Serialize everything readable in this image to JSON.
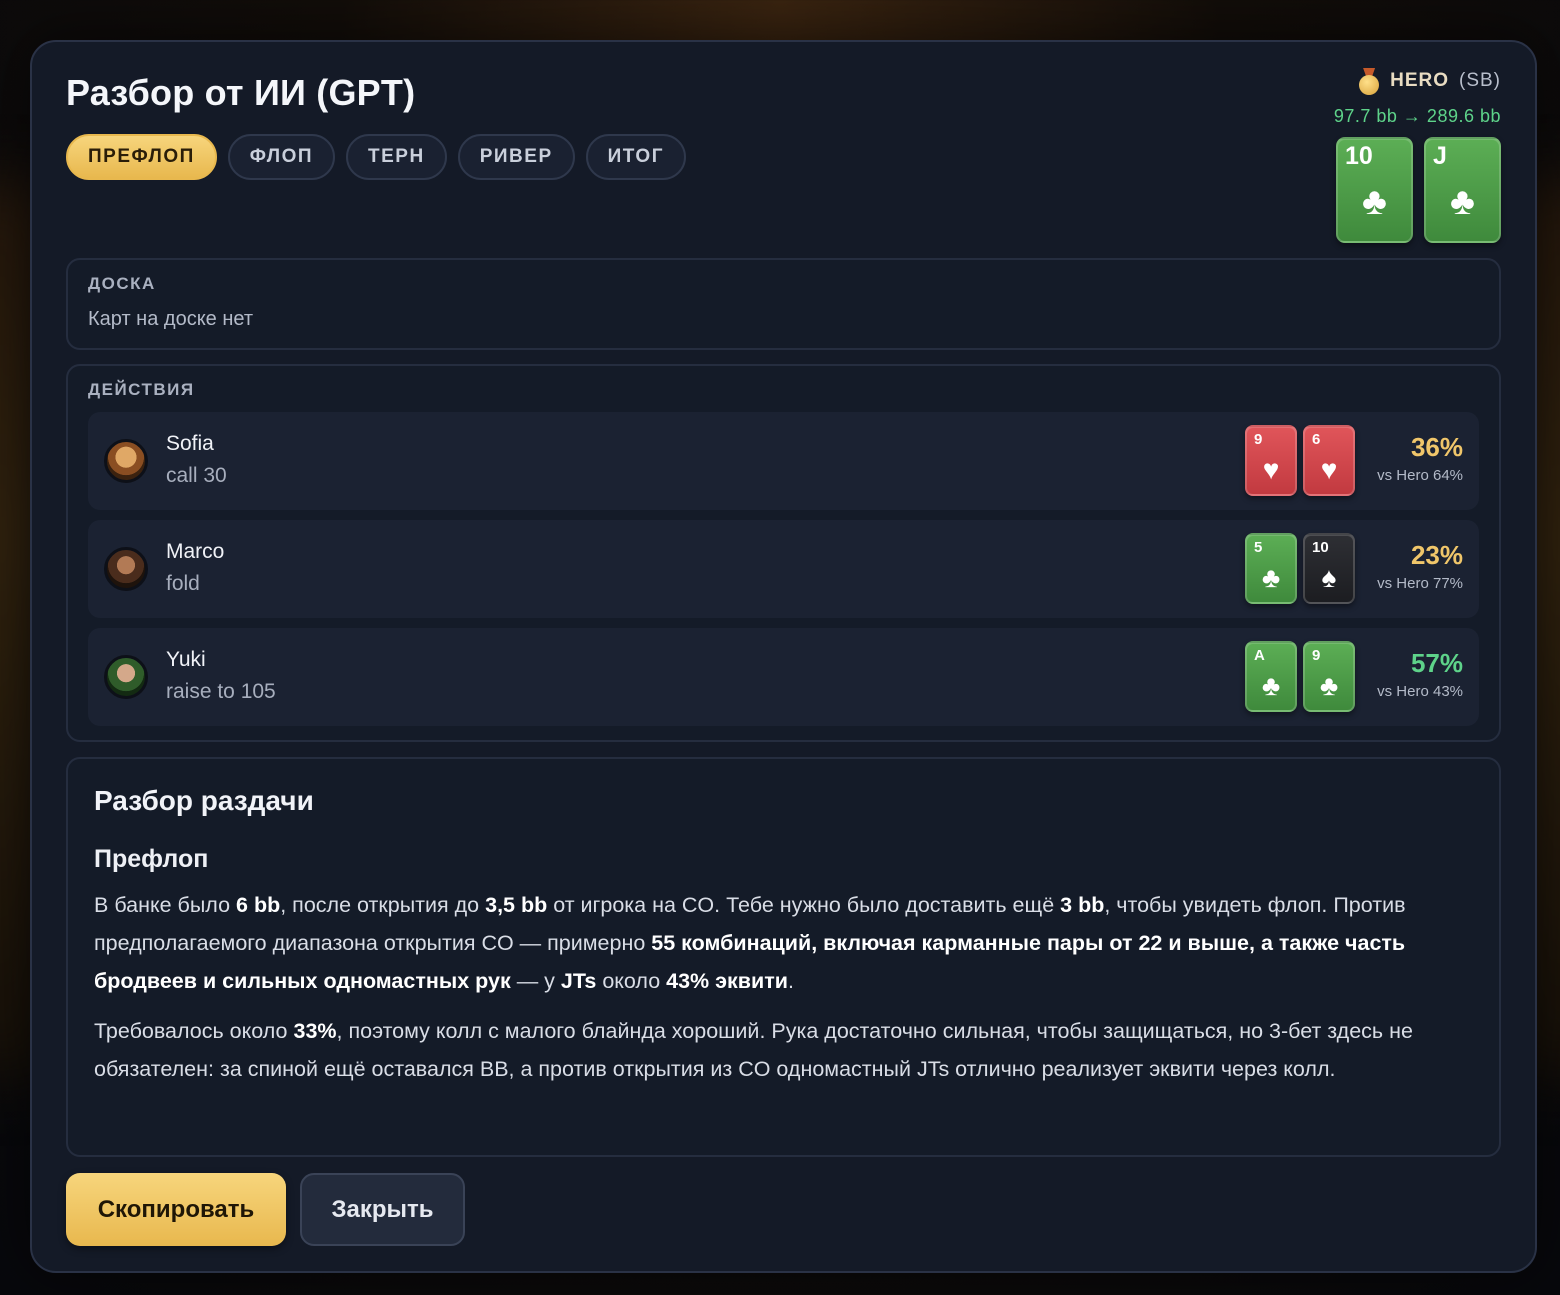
{
  "modal": {
    "title": "Разбор от ИИ (GPT)"
  },
  "tabs": [
    {
      "label": "ПРЕФЛОП",
      "active": true
    },
    {
      "label": "ФЛОП"
    },
    {
      "label": "ТЕРН"
    },
    {
      "label": "РИВЕР"
    },
    {
      "label": "ИТОГ"
    }
  ],
  "hero": {
    "name": "HERO",
    "position": "(SB)",
    "stack": "97.7 bb → 289.6 bb",
    "cards": [
      {
        "rank": "10",
        "suit": "♣",
        "color": "green"
      },
      {
        "rank": "J",
        "suit": "♣",
        "color": "green"
      }
    ]
  },
  "board": {
    "label": "ДОСКА",
    "empty_text": "Карт на доске нет"
  },
  "actions": {
    "label": "ДЕЙСТВИЯ",
    "rows": [
      {
        "player": "Sofia",
        "action": "call 30",
        "cards": [
          {
            "rank": "9",
            "suit": "♥",
            "color": "red"
          },
          {
            "rank": "6",
            "suit": "♥",
            "color": "red"
          }
        ],
        "equity": "36%",
        "vs": "vs Hero 64%",
        "equity_color": "#f0c66a"
      },
      {
        "player": "Marco",
        "action": "fold",
        "cards": [
          {
            "rank": "5",
            "suit": "♣",
            "color": "green"
          },
          {
            "rank": "10",
            "suit": "♠",
            "color": "black"
          }
        ],
        "equity": "23%",
        "vs": "vs Hero 77%",
        "equity_color": "#f0c66a"
      },
      {
        "player": "Yuki",
        "action": "raise to 105",
        "cards": [
          {
            "rank": "A",
            "suit": "♣",
            "color": "green"
          },
          {
            "rank": "9",
            "suit": "♣",
            "color": "green"
          }
        ],
        "equity": "57%",
        "vs": "vs Hero 43%",
        "equity_color": "#5ed38a"
      }
    ]
  },
  "analysis": {
    "title": "Разбор раздачи",
    "section": "Префлоп",
    "p1": [
      {
        "t": "В банке было "
      },
      {
        "t": "6 bb",
        "b": true
      },
      {
        "t": ", после открытия до "
      },
      {
        "t": "3,5 bb",
        "b": true
      },
      {
        "t": " от игрока на CO. Тебе нужно было доставить ещё "
      },
      {
        "t": "3 bb",
        "b": true
      },
      {
        "t": ", чтобы увидеть флоп. Против предполагаемого диапазона открытия CO — примерно "
      },
      {
        "t": "55 комбинаций, включая карманные пары от 22 и выше, а также часть бродвеев и сильных одномастных рук",
        "b": true
      },
      {
        "t": " — у "
      },
      {
        "t": "JTs",
        "b": true
      },
      {
        "t": " около "
      },
      {
        "t": "43% эквити",
        "b": true
      },
      {
        "t": "."
      }
    ],
    "p2": [
      {
        "t": "Требовалось около "
      },
      {
        "t": "33%",
        "b": true
      },
      {
        "t": ", поэтому колл с малого блайнда хороший. Рука достаточно сильная, чтобы защищаться, но 3-бет здесь не обязателен: за спиной ещё оставался BB, а против открытия из CO одномастный JTs отлично реализует эквити через колл."
      }
    ]
  },
  "buttons": {
    "copy": "Скопировать",
    "close": "Закрыть"
  },
  "colors": {
    "accent_gold": "#e8b84e",
    "positive_green": "#5ed38a",
    "background": "#141a27"
  }
}
